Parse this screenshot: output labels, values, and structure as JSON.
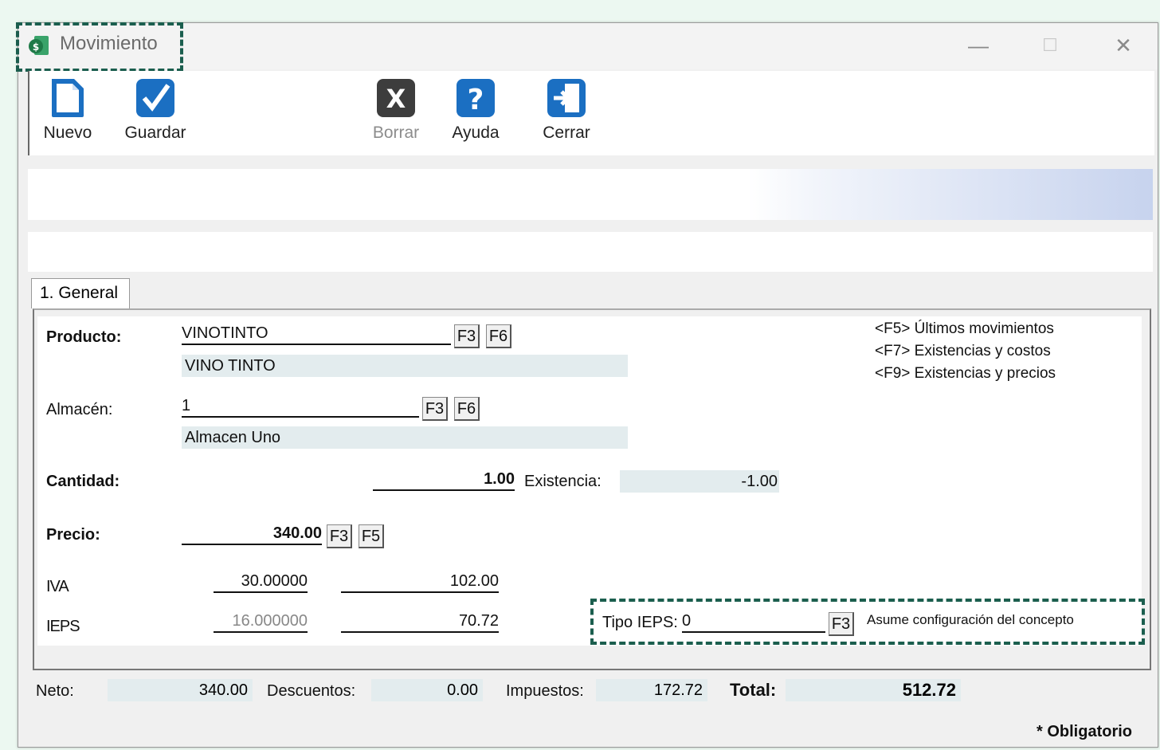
{
  "window": {
    "title": "Movimiento",
    "controls": {
      "minimize": "—",
      "maximize": "☐",
      "close": "✕"
    }
  },
  "toolbar": {
    "nuevo": "Nuevo",
    "guardar": "Guardar",
    "borrar": "Borrar",
    "ayuda": "Ayuda",
    "cerrar": "Cerrar"
  },
  "tab": {
    "label": "1. General"
  },
  "form": {
    "producto": {
      "label": "Producto:",
      "code": "VINOTINTO",
      "name": "VINO TINTO"
    },
    "almacen": {
      "label": "Almacén:",
      "code": "1",
      "name": "Almacen Uno"
    },
    "cantidad": {
      "label": "Cantidad:",
      "value": "1.00",
      "existencia_label": "Existencia:",
      "existencia": "-1.00"
    },
    "precio": {
      "label": "Precio:",
      "value": "340.00"
    },
    "iva": {
      "label": "IVA",
      "rate": "30.00000",
      "amount": "102.00"
    },
    "ieps": {
      "label": "IEPS",
      "rate": "16.000000",
      "amount": "70.72"
    },
    "tipo_ieps": {
      "label": "Tipo IEPS:",
      "value": "0",
      "description": "Asume configuración del concepto"
    },
    "fkeys": {
      "f3": "F3",
      "f5": "F5",
      "f6": "F6"
    }
  },
  "help": {
    "line1": "<F5> Últimos movimientos",
    "line2": "<F7> Existencias y costos",
    "line3": "<F9> Existencias y precios"
  },
  "summary": {
    "neto_label": "Neto:",
    "neto": "340.00",
    "descuentos_label": "Descuentos:",
    "descuentos": "0.00",
    "impuestos_label": "Impuestos:",
    "impuestos": "172.72",
    "total_label": "Total:",
    "total": "512.72"
  },
  "footer": {
    "obligatorio": "* Obligatorio"
  },
  "colors": {
    "accent": "#1b6fc2",
    "dash": "#1b5e4e",
    "readonly_bg": "#e3ecee"
  }
}
